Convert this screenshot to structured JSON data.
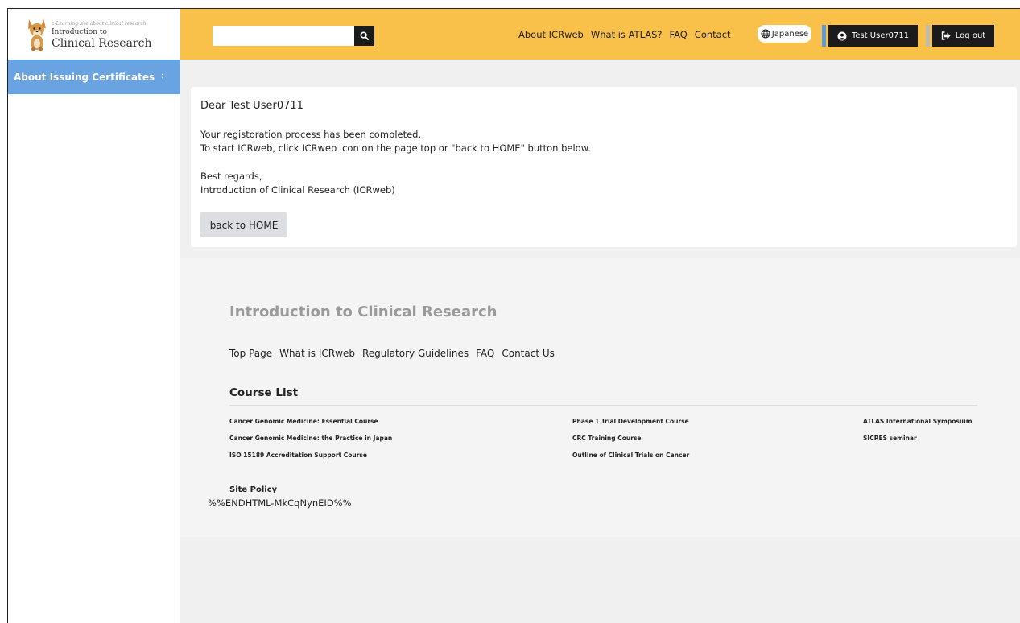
{
  "logo": {
    "tagline": "e-Learning site about clinical research",
    "subtitle": "Introduction to",
    "title": "Clinical Research"
  },
  "header": {
    "search": {
      "value": "",
      "placeholder": ""
    },
    "nav": [
      "About ICRweb",
      "What is ATLAS?",
      "FAQ",
      "Contact"
    ],
    "language_label": "Japanese",
    "user_label": "Test User0711",
    "logout_label": "Log out"
  },
  "sidebar": {
    "items": [
      {
        "label": "About Issuing Certificates"
      }
    ]
  },
  "message": {
    "greeting": "Dear Test User0711",
    "line1": "Your registoration process has been completed.",
    "line2": "To start ICRweb, click ICRweb icon on the page top or \"back to HOME\" button below.",
    "closing1": "Best regards,",
    "closing2": "Introduction of Clinical Research (ICRweb)",
    "home_button": "back to HOME"
  },
  "footer": {
    "title": "Introduction to Clinical Research",
    "links": [
      "Top Page",
      "What is ICRweb",
      "Regulatory Guidelines",
      "FAQ",
      "Contact Us"
    ],
    "course_list_heading": "Course List",
    "courses": [
      [
        "Cancer Genomic Medicine: Essential Course",
        "Cancer Genomic Medicine: the Practice in Japan",
        "ISO 15189 Accreditation Support Course"
      ],
      [
        "Phase 1 Trial Development Course",
        "CRC Training Course",
        "Outline of Clinical Trials on Cancer"
      ],
      [
        "ATLAS International Symposium",
        "SICRES seminar"
      ]
    ],
    "site_policy": "Site Policy",
    "trailing_text": "%%ENDHTML-MkCqNynEID%%"
  },
  "colors": {
    "header_bg": "#f9c04a",
    "sidebar_active": "#6aa3e2",
    "dark_button": "#1b1b1b",
    "user_accent": "#5b9be0"
  }
}
